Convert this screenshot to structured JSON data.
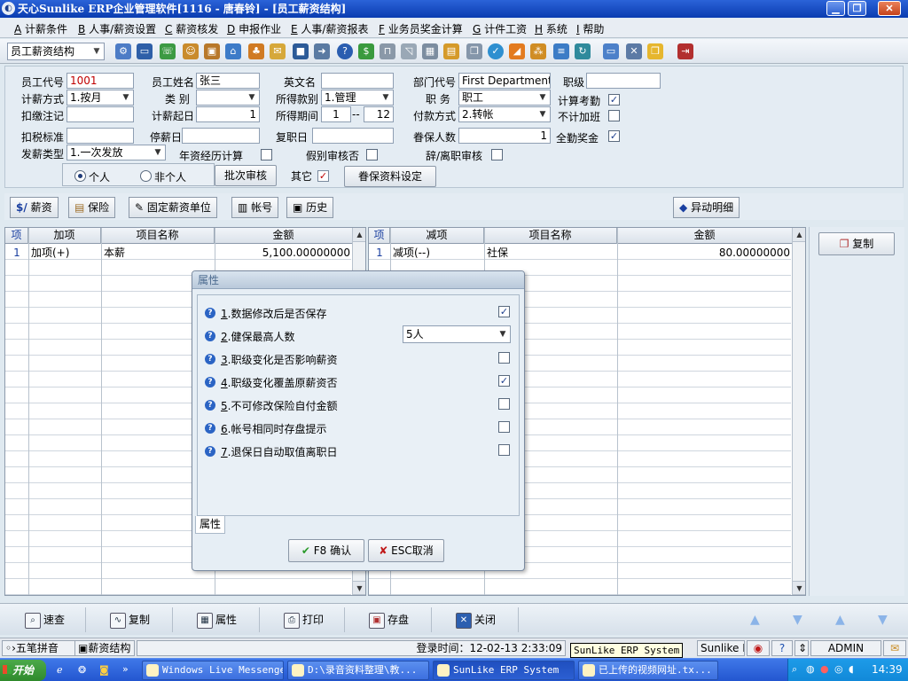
{
  "window": {
    "title": "天心Sunlike ERP企业管理软件[1116 - 唐春铃] - [员工薪资结构]",
    "app_icon": "sunlike-logo-icon"
  },
  "menu": [
    {
      "key": "A",
      "label": "计薪条件"
    },
    {
      "key": "B",
      "label": "人事/薪资设置"
    },
    {
      "key": "C",
      "label": "薪资核发"
    },
    {
      "key": "D",
      "label": "申报作业"
    },
    {
      "key": "E",
      "label": "人事/薪资报表"
    },
    {
      "key": "F",
      "label": "业务员奖金计算"
    },
    {
      "key": "G",
      "label": "计件工资"
    },
    {
      "key": "H",
      "label": "系统"
    },
    {
      "key": "I",
      "label": "帮助"
    }
  ],
  "toolbar": {
    "module_select": "员工薪资结构"
  },
  "form": {
    "emp_code_label": "员工代号",
    "emp_code": "1001",
    "emp_name_label": "员工姓名",
    "emp_name": "张三",
    "en_name_label": "英文名",
    "en_name": "",
    "dept_code_label": "部门代号",
    "dept_code": "First Department",
    "rank_label": "职级",
    "rank": "",
    "calc_method_label": "计薪方式",
    "calc_method": "1.按月",
    "category_label": "类  别",
    "category": "",
    "income_type_label": "所得款别",
    "income_type": "1.管理",
    "position_label": "职  务",
    "position": "职工",
    "calc_attendance_label": "计算考勤",
    "calc_attendance": true,
    "deduct_note_label": "扣缴注记",
    "deduct_note": "",
    "calc_start_label": "计薪起日",
    "calc_start": "1",
    "income_period_label": "所得期间",
    "period_from": "1",
    "period_sep": "--",
    "period_to": "12",
    "pay_method_label": "付款方式",
    "pay_method": "2.转帐",
    "no_overtime_label": "不计加班",
    "no_overtime": false,
    "tax_std_label": "扣税标准",
    "tax_std": "",
    "stop_date_label": "停薪日",
    "stop_date": "",
    "resume_date_label": "复职日",
    "resume_date": "",
    "dependents_label": "眷保人数",
    "dependents": "1",
    "full_bonus_label": "全勤奖金",
    "full_bonus": true,
    "pay_type_label": "发薪类型",
    "pay_type": "1.一次发放",
    "seniority_label": "年资经历计算",
    "seniority": false,
    "leave_audit_label": "假别审核否",
    "leave_audit": false,
    "resign_audit_label": "辞/离职审核",
    "resign_audit": false,
    "radio_personal": "个人",
    "radio_nonpersonal": "非个人",
    "batch_audit_btn": "批次审核",
    "other_label": "其它",
    "other_checked": true,
    "dependent_setup_btn": "眷保资料设定"
  },
  "tabs": [
    {
      "label": "薪资",
      "icon": "salary-icon"
    },
    {
      "label": "保险",
      "icon": "insurance-icon"
    },
    {
      "label": "固定薪资单位",
      "icon": "fixed-salary-icon"
    },
    {
      "label": "帐号",
      "icon": "account-icon"
    },
    {
      "label": "历史",
      "icon": "history-icon"
    }
  ],
  "change_detail_btn": "异动明细",
  "add_grid": {
    "headers": [
      "项",
      "加项",
      "项目名称",
      "金额"
    ],
    "rows": [
      {
        "no": "1",
        "type": "加项(+)",
        "name": "本薪",
        "amount": "5,100.00000000"
      }
    ]
  },
  "sub_grid": {
    "headers": [
      "项",
      "减项",
      "项目名称",
      "金额"
    ],
    "rows": [
      {
        "no": "1",
        "type": "减项(--)",
        "name": "社保",
        "amount": "80.00000000"
      }
    ]
  },
  "copy_btn": "复制",
  "dialog": {
    "title": "属性",
    "items": [
      {
        "no": "1",
        "text": ".数据修改后是否保存",
        "type": "check",
        "checked": true
      },
      {
        "no": "2",
        "text": ".健保最高人数",
        "type": "select",
        "value": "5人"
      },
      {
        "no": "3",
        "text": ".职级变化是否影响薪资",
        "type": "check",
        "checked": false
      },
      {
        "no": "4",
        "text": ".职级变化覆盖原薪资否",
        "type": "check",
        "checked": true
      },
      {
        "no": "5",
        "text": ".不可修改保险自付金额",
        "type": "check",
        "checked": false
      },
      {
        "no": "6",
        "text": ".帐号相同时存盘提示",
        "type": "check",
        "checked": false
      },
      {
        "no": "7",
        "text": ".退保日自动取值离职日",
        "type": "check",
        "checked": false
      }
    ],
    "tab_label": "属性",
    "ok_btn": "F8 确认",
    "cancel_btn": "ESC取消"
  },
  "bottom_buttons": [
    "速查",
    "复制",
    "属性",
    "打印",
    "存盘",
    "关闭"
  ],
  "statusbar": {
    "ime": "五笔拼音",
    "module": "薪资结构",
    "login_time": "登录时间：12-02-13 2:33:09",
    "company": "Sunlike E",
    "user": "ADMIN"
  },
  "tooltip": "SunLike ERP System",
  "taskbar": {
    "start": "开始",
    "tasks": [
      "Windows Live Messenger",
      "D:\\录音资料整理\\教...",
      "SunLike ERP System",
      "已上传的视频网址.tx..."
    ],
    "time": "14:39"
  }
}
